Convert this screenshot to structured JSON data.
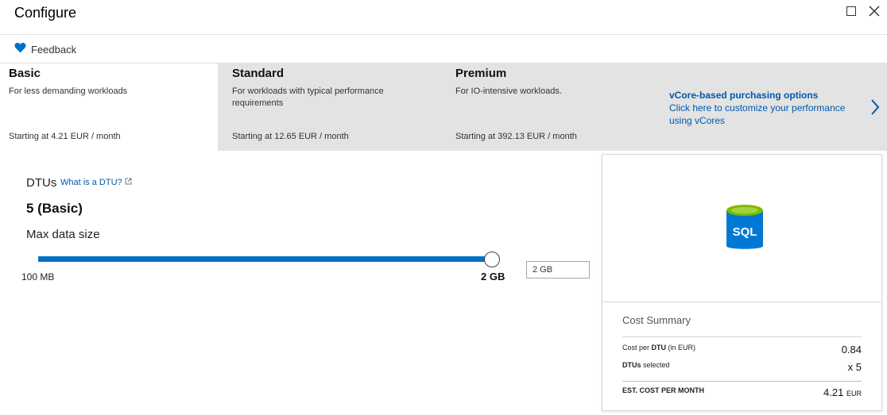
{
  "window": {
    "title": "Configure"
  },
  "commands": {
    "feedback": "Feedback"
  },
  "tiers": [
    {
      "name": "Basic",
      "description": "For less demanding workloads",
      "price": "Starting at 4.21 EUR / month"
    },
    {
      "name": "Standard",
      "description": "For workloads with typical performance requirements",
      "price": "Starting at 12.65 EUR / month"
    },
    {
      "name": "Premium",
      "description": "For IO-intensive workloads.",
      "price": "Starting at 392.13 EUR / month"
    }
  ],
  "selected_tier": "Basic",
  "vcore": {
    "title": "vCore-based purchasing options",
    "description": "Click here to customize your performance using vCores"
  },
  "dtu": {
    "label": "DTUs",
    "link": "What is a DTU?",
    "value": "5 (Basic)"
  },
  "max_size": {
    "label": "Max data size",
    "min_label": "100 MB",
    "max_label": "2 GB",
    "input_value": "2 GB",
    "slider_fraction": 1.0
  },
  "summary": {
    "icon_text": "SQL",
    "title": "Cost Summary",
    "cost_per_dtu_prefix": "Cost per ",
    "cost_per_dtu_bold": "DTU",
    "cost_per_dtu_suffix": " (in EUR)",
    "cost_per_dtu_value": "0.84",
    "dtus_selected_bold": "DTUs",
    "dtus_selected_suffix": " selected",
    "dtus_selected_value": "x 5",
    "est_label": "EST. COST PER MONTH",
    "est_value": "4.21",
    "est_unit": "EUR"
  },
  "colors": {
    "accent": "#0072c6",
    "link": "#0058ad",
    "tier_unselected_bg": "#e3e3e3",
    "sql_icon_body": "#0078d4",
    "sql_icon_top": "#7fba00"
  }
}
